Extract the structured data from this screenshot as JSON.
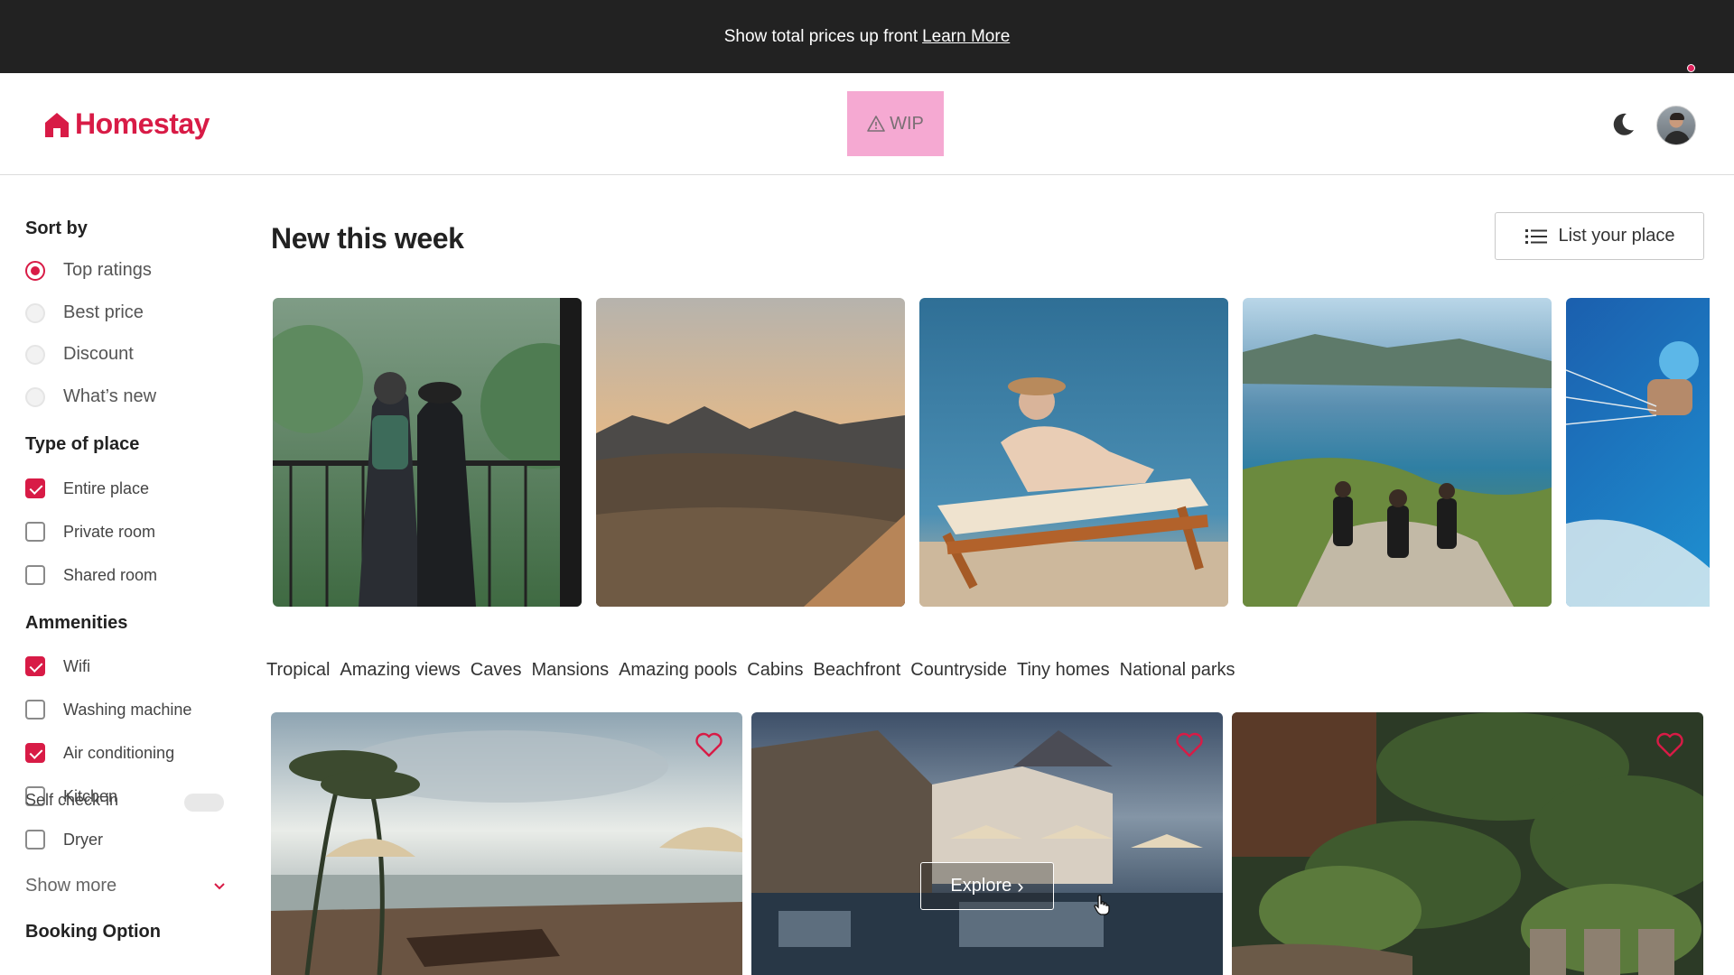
{
  "banner": {
    "text": "Show total prices up front",
    "link": "Learn More"
  },
  "header": {
    "brand": "Homestay",
    "wip_label": "WIP",
    "theme_icon": "moon-icon",
    "avatar_icon": "user-avatar"
  },
  "sidebar": {
    "sort_title": "Sort by",
    "sort_options": [
      {
        "label": "Top ratings",
        "selected": true
      },
      {
        "label": "Best price",
        "selected": false
      },
      {
        "label": "Discount",
        "selected": false
      },
      {
        "label": "What’s new",
        "selected": false
      }
    ],
    "type_title": "Type of place",
    "type_options": [
      {
        "label": "Entire place",
        "checked": true
      },
      {
        "label": "Private room",
        "checked": false
      },
      {
        "label": "Shared room",
        "checked": false
      }
    ],
    "amenities_title": "Ammenities",
    "amenities": [
      {
        "label": "Wifi",
        "checked": true
      },
      {
        "label": "Washing machine",
        "checked": false
      },
      {
        "label": "Air conditioning",
        "checked": true
      },
      {
        "label": "Kitchen",
        "checked": false
      },
      {
        "label": "Dryer",
        "checked": false
      }
    ],
    "show_more": "Show more",
    "booking_title": "Booking Option",
    "self_booking": "Self check-in"
  },
  "main": {
    "title": "New this week",
    "list_button": "List your place",
    "categories": [
      "Tropical",
      "Amazing views",
      "Caves",
      "Mansions",
      "Amazing pools",
      "Cabins",
      "Beachfront",
      "Countryside",
      "Tiny homes",
      "National parks"
    ],
    "explore_label": "Explore"
  },
  "colors": {
    "accent": "#d81b46",
    "banner_bg": "#222222",
    "wip_bg": "#f5a9d2"
  }
}
